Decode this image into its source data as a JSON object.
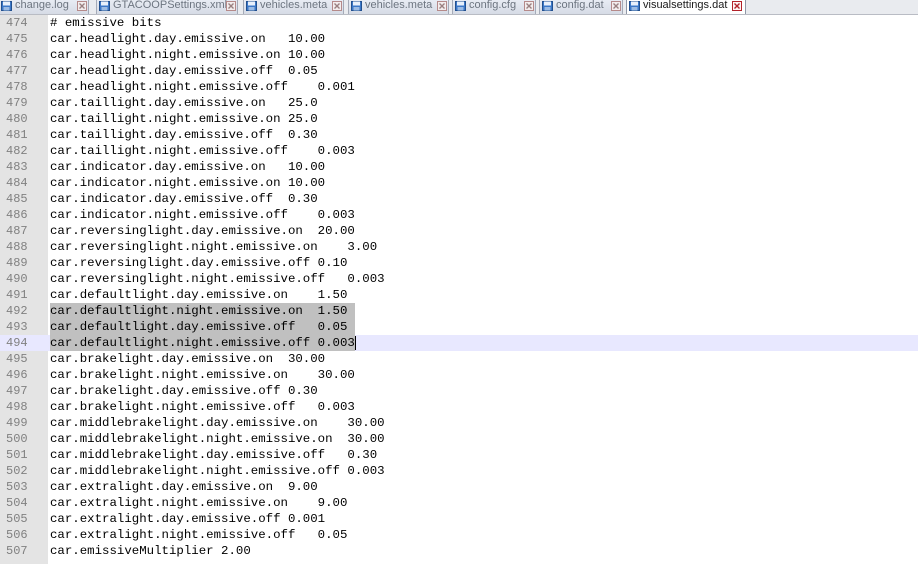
{
  "tabs": [
    {
      "label": "change.log",
      "active": false
    },
    {
      "label": "GTACOOPSettings.xml",
      "active": false
    },
    {
      "label": "vehicles.meta",
      "active": false
    },
    {
      "label": "vehicles.meta",
      "active": false
    },
    {
      "label": "config.cfg",
      "active": false
    },
    {
      "label": "config.dat",
      "active": false
    },
    {
      "label": "visualsettings.dat",
      "active": true
    }
  ],
  "icons": {
    "tab_file": "save-icon",
    "tab_close": "close-icon"
  },
  "colors": {
    "selection": "#c0c0c0",
    "current_line": "#e8e8ff",
    "gutter": "#e4e4e4",
    "line_number": "#808080",
    "close_active": "#b2222a"
  },
  "editor": {
    "lines": [
      {
        "number": "474",
        "text": "# emissive bits"
      },
      {
        "number": "475",
        "text": "car.headlight.day.emissive.on   10.00"
      },
      {
        "number": "476",
        "text": "car.headlight.night.emissive.on 10.00"
      },
      {
        "number": "477",
        "text": "car.headlight.day.emissive.off  0.05"
      },
      {
        "number": "478",
        "text": "car.headlight.night.emissive.off    0.001"
      },
      {
        "number": "479",
        "text": "car.taillight.day.emissive.on   25.0"
      },
      {
        "number": "480",
        "text": "car.taillight.night.emissive.on 25.0"
      },
      {
        "number": "481",
        "text": "car.taillight.day.emissive.off  0.30"
      },
      {
        "number": "482",
        "text": "car.taillight.night.emissive.off    0.003"
      },
      {
        "number": "483",
        "text": "car.indicator.day.emissive.on   10.00"
      },
      {
        "number": "484",
        "text": "car.indicator.night.emissive.on 10.00"
      },
      {
        "number": "485",
        "text": "car.indicator.day.emissive.off  0.30"
      },
      {
        "number": "486",
        "text": "car.indicator.night.emissive.off    0.003"
      },
      {
        "number": "487",
        "text": "car.reversinglight.day.emissive.on  20.00"
      },
      {
        "number": "488",
        "text": "car.reversinglight.night.emissive.on    3.00"
      },
      {
        "number": "489",
        "text": "car.reversinglight.day.emissive.off 0.10"
      },
      {
        "number": "490",
        "text": "car.reversinglight.night.emissive.off   0.003"
      },
      {
        "number": "491",
        "text": "car.defaultlight.day.emissive.on    1.50"
      },
      {
        "number": "492",
        "text": "car.defaultlight.night.emissive.on  1.50"
      },
      {
        "number": "493",
        "text": "car.defaultlight.day.emissive.off   0.05"
      },
      {
        "number": "494",
        "text": "car.defaultlight.night.emissive.off 0.003"
      },
      {
        "number": "495",
        "text": "car.brakelight.day.emissive.on  30.00"
      },
      {
        "number": "496",
        "text": "car.brakelight.night.emissive.on    30.00"
      },
      {
        "number": "497",
        "text": "car.brakelight.day.emissive.off 0.30"
      },
      {
        "number": "498",
        "text": "car.brakelight.night.emissive.off   0.003"
      },
      {
        "number": "499",
        "text": "car.middlebrakelight.day.emissive.on    30.00"
      },
      {
        "number": "500",
        "text": "car.middlebrakelight.night.emissive.on  30.00"
      },
      {
        "number": "501",
        "text": "car.middlebrakelight.day.emissive.off   0.30"
      },
      {
        "number": "502",
        "text": "car.middlebrakelight.night.emissive.off 0.003"
      },
      {
        "number": "503",
        "text": "car.extralight.day.emissive.on  9.00"
      },
      {
        "number": "504",
        "text": "car.extralight.night.emissive.on    9.00"
      },
      {
        "number": "505",
        "text": "car.extralight.day.emissive.off 0.001"
      },
      {
        "number": "506",
        "text": "car.extralight.night.emissive.off   0.05"
      },
      {
        "number": "507",
        "text": "car.emissiveMultiplier 2.00"
      }
    ],
    "selected_line_numbers": [
      "492",
      "493",
      "494"
    ],
    "current_line_number": "494"
  }
}
